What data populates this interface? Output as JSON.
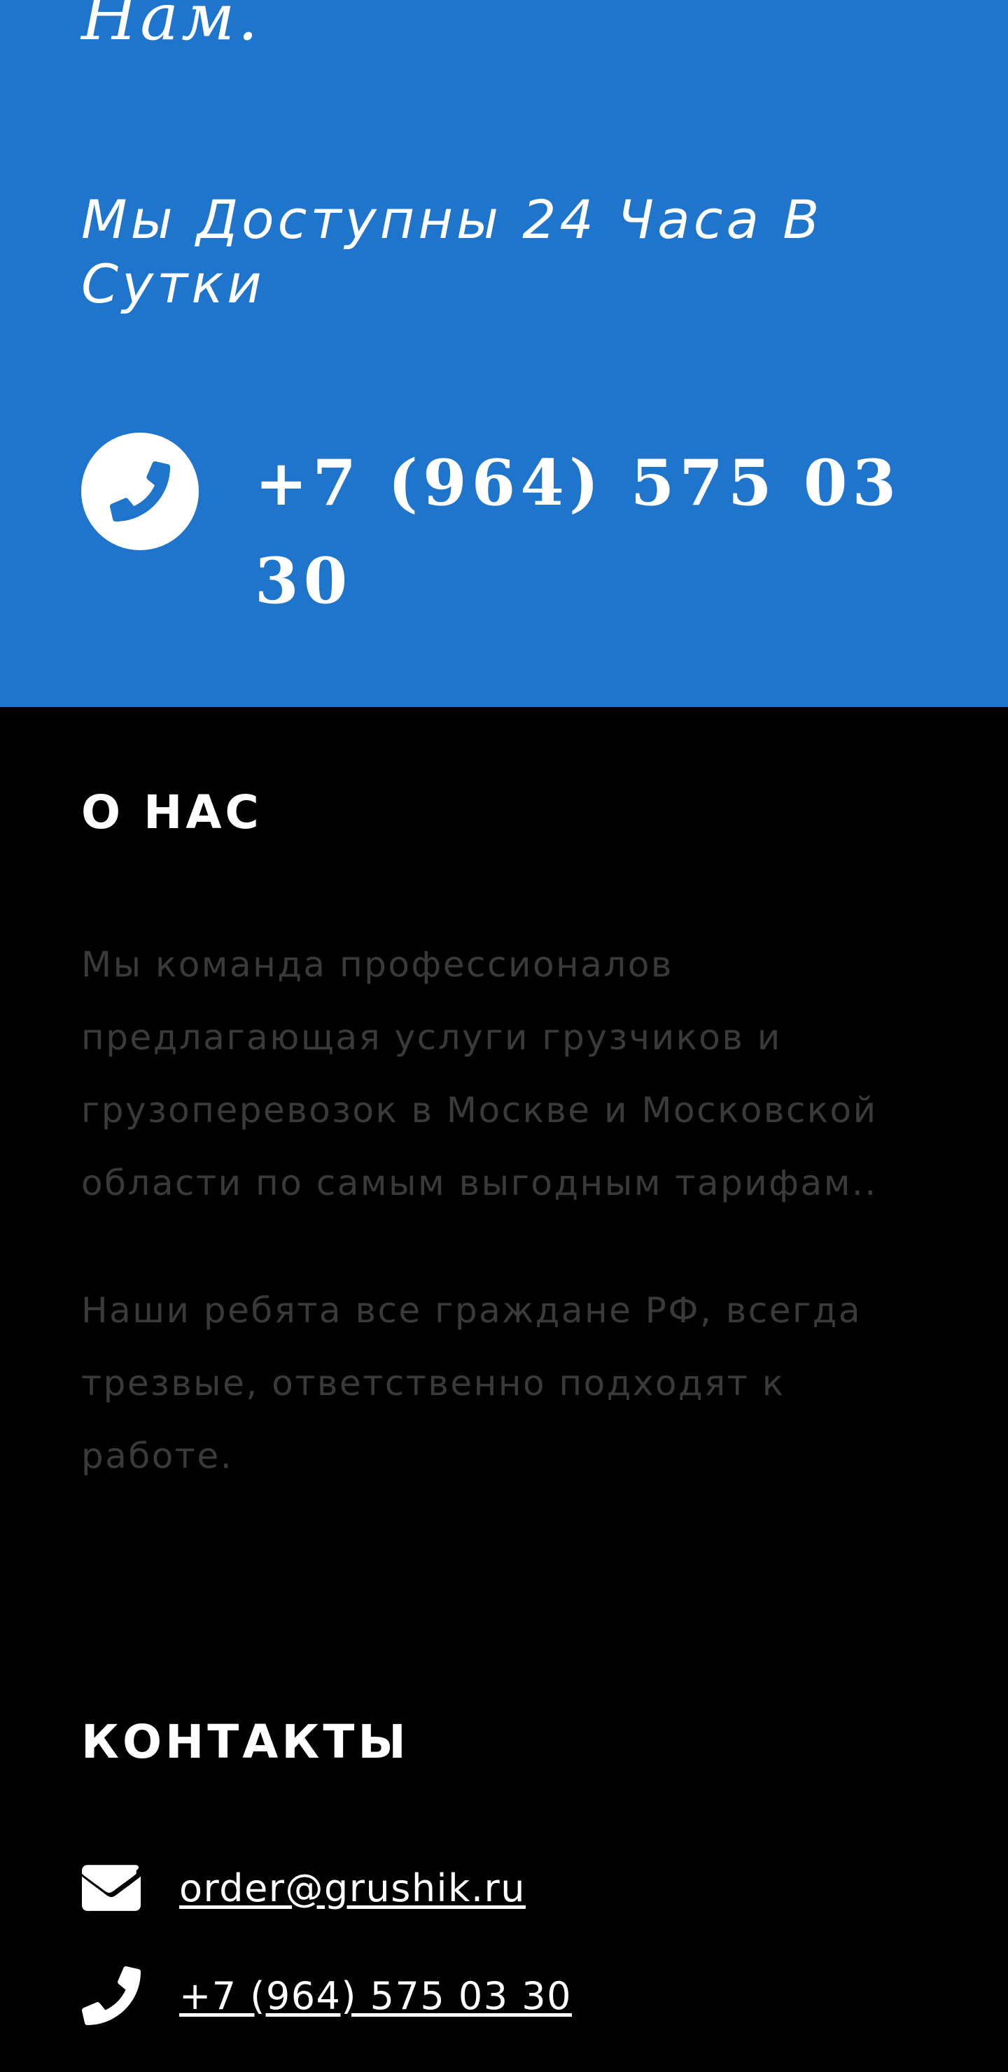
{
  "cta": {
    "heading_tail": "Нам.",
    "availability": "Мы Доступны 24 Часа В Сутки",
    "phone": "+7 (964) 575 03 30",
    "phone_icon": "phone-icon"
  },
  "about": {
    "title": "О НАС",
    "paragraphs": [
      "Мы команда профессионалов предлагающая услуги грузчиков и грузоперевозок в Москве и Московской области по самым выгодным тарифам..",
      "Наши ребята все граждане РФ, всегда трезвые, ответственно подходят к работе."
    ]
  },
  "contacts": {
    "title": "КОНТАКТЫ",
    "email": "order@grushik.ru",
    "email_icon": "envelope-icon",
    "phone": "+7 (964) 575 03 30",
    "phone_icon": "phone-icon"
  },
  "colors": {
    "cta_background": "#1f74cb",
    "footer_background": "#000000",
    "footer_text_muted": "#3a3a3a",
    "text_white": "#ffffff"
  }
}
